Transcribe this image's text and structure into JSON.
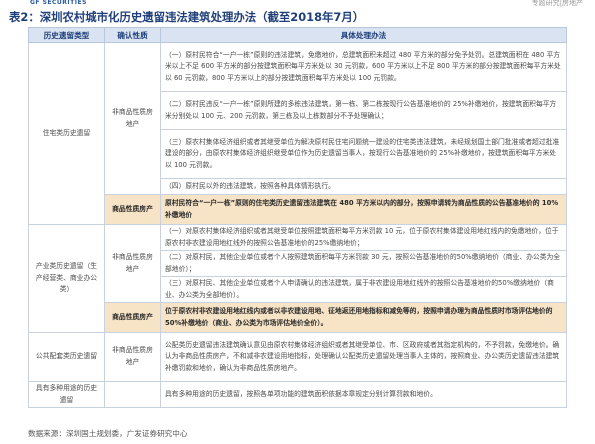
{
  "header": {
    "logo_text": "GF SECURITIES",
    "right_text": "专题研究|房地产"
  },
  "caption": "表2：深圳农村城市化历史遗留违法建筑处理办法（截至2018年7月）",
  "table": {
    "headers": [
      "历史遗留类型",
      "确认性质",
      "具体处理办法"
    ],
    "rows": {
      "r1": {
        "type": "住宅类历史遗留",
        "conf": "非商品性质房地产",
        "methods": [
          "（一）原村民符合“一户一栋”原则的违法建筑，免缴地价，总建筑面积未超过 480 平方米的部分免予处罚。总建筑面积在 480 平方米以上不足 600 平方米的部分按建筑面积每平方米处以 30 元罚款，600 平方米以上不足 800 平方米的部分按建筑面积每平方米处以 60 元罚款，800 平方米以上的部分按建筑面积每平方米处以 100 元罚款。",
          "（二）原村民违反“一户一栋”原则所建的多栋违法建筑，第一栋、第二栋按现行公告基准地价的 25%补缴地价，按建筑面积每平方米分别处以 100 元、200 元罚款，第三栋及以上栋数部分不予处理确认；",
          "（三）原农村集体经济组织或者其继受单位为解决原村民住宅问题统一建设的住宅类违法建筑，未经规划国土部门批准或者超过批准建设的部分，由原农村集体经济组织继受单位作为历史遗留当事人，按现行公告基准地价的 25%补缴地价，按建筑面积每平方米处以 100 元罚款。",
          "（四）原村民以外的违法建筑，按照各种具体情形执行。"
        ]
      },
      "r2": {
        "conf": "商品性质房产",
        "method": "原村民符合“一户一栋”原则的住宅类历史遗留违法建筑在 480 平方米以内的部分，按照申请转为商品性质的公告基准地价的 10%补缴地价"
      },
      "r3": {
        "type": "产业类历史遗留（生产经营类、商业办公类）",
        "conf": "非商品性质房地产",
        "methods": [
          "（一）对原农村集体经济组织或者其继受单位按照建筑面积每平方米罚款 10 元，位于原农村集体建设用地红线内的免缴地价，位于原农村非农建设用地红线外的按照公告基准地价的25%缴纳地价；",
          "（二）对原村民，其他企业单位或者个人按照建筑面积每平方米罚款 30 元，按照公告基准地价的50%缴纳地价（商业、办公类为全部地价）；",
          "（三）对原村民、其他企业单位或者个人申请确认的违法建筑，属于非农建设用地红线外的按照公告基准地价的50%缴纳地价（商业、办公类为全部地价）。"
        ]
      },
      "r4": {
        "conf": "商品性质房产",
        "method": "位于原农村非农建设用地红线内或者以非农建设用地、征地返还用地指标和减免等的，按照申请办理为商品性质时市场评估地价的 50%补缴地价（商业、办公类为市场评估地价全价）。"
      },
      "r5": {
        "type": "公共配套类历史遗留",
        "conf": "非商品性质房地产",
        "method": "公配类历史遗留违法建筑确认意见由原农村集体经济组织或者其继受单位、市、区政府或者其指定机构的，不予罚款，免缴地价。确认为非商品性质房产，不和减非农建设用地指标，处理确认公配类历史遗留处理当事人主体的，按照商业、办公类历史遗留违法建筑补缴罚款和地价，确认为非商品性质房地产。"
      },
      "r6": {
        "type": "具有多种用途的历史遗留",
        "method": "具有多种用途的历史遗留，按照各单项功能的建筑面积依据本章规定分别计算罚款和地价。"
      }
    }
  },
  "source": "数据来源：深圳国土规划委，广发证券研究中心"
}
